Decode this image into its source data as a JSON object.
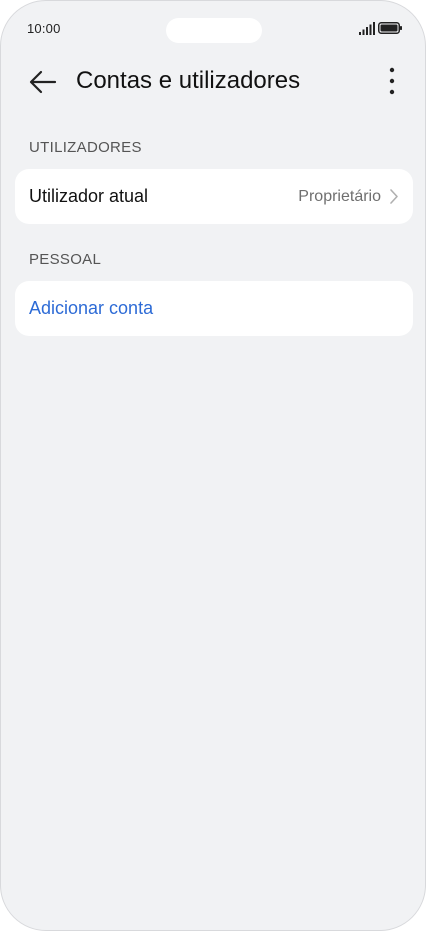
{
  "status_bar": {
    "time": "10:00"
  },
  "header": {
    "title": "Contas e utilizadores",
    "back_icon": "arrow-left-icon",
    "more_icon": "more-vertical-icon"
  },
  "sections": {
    "users": {
      "header": "UTILIZADORES",
      "current_user_label": "Utilizador atual",
      "current_user_value": "Proprietário"
    },
    "personal": {
      "header": "PESSOAL",
      "add_account_label": "Adicionar conta"
    }
  },
  "colors": {
    "background": "#f1f2f4",
    "card": "#ffffff",
    "accent_link": "#2d6bd6"
  }
}
